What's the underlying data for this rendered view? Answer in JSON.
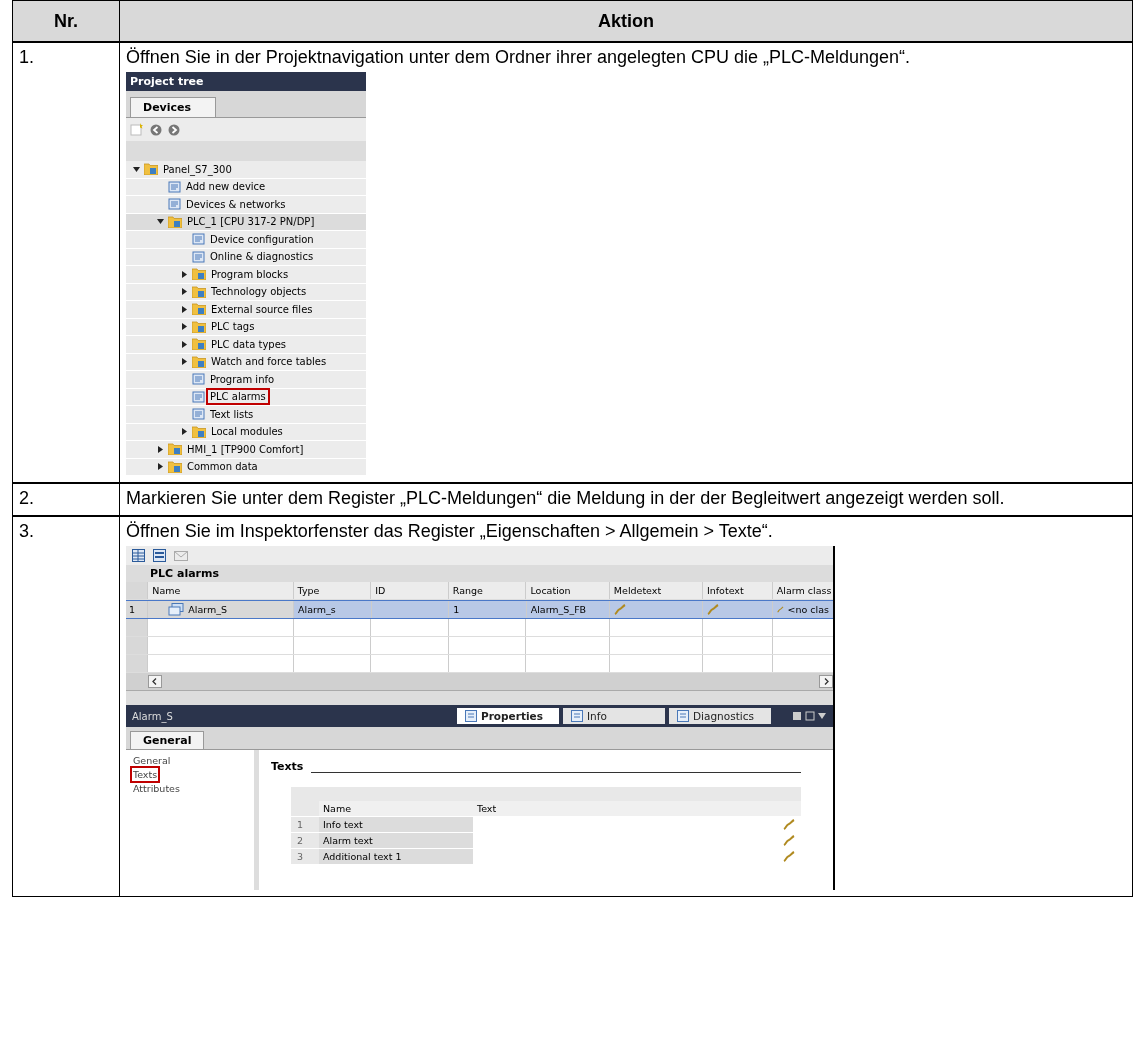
{
  "table": {
    "columns": [
      "Nr.",
      "Aktion"
    ],
    "rows": [
      {
        "number": "1.",
        "text": "Öffnen Sie in der Projektnavigation unter dem Ordner ihrer angelegten CPU die „PLC-Meldungen“.",
        "figure": {
          "kind": "project_tree",
          "title": "Project tree",
          "tab": "Devices",
          "items": [
            {
              "label": "Panel_S7_300",
              "expanded": true,
              "highlighted": false,
              "children": [
                {
                  "label": "Add new device",
                  "highlighted": false
                },
                {
                  "label": "Devices & networks",
                  "highlighted": false
                },
                {
                  "label": "PLC_1 [CPU 317-2 PN/DP]",
                  "expanded": true,
                  "highlighted": false,
                  "children": [
                    {
                      "label": "Device configuration",
                      "highlighted": false
                    },
                    {
                      "label": "Online & diagnostics",
                      "highlighted": false
                    },
                    {
                      "label": "Program blocks",
                      "expanded": false,
                      "highlighted": false
                    },
                    {
                      "label": "Technology objects",
                      "expanded": false,
                      "highlighted": false
                    },
                    {
                      "label": "External source files",
                      "expanded": false,
                      "highlighted": false
                    },
                    {
                      "label": "PLC tags",
                      "expanded": false,
                      "highlighted": false
                    },
                    {
                      "label": "PLC data types",
                      "expanded": false,
                      "highlighted": false
                    },
                    {
                      "label": "Watch and force tables",
                      "expanded": false,
                      "highlighted": false
                    },
                    {
                      "label": "Program info",
                      "highlighted": false
                    },
                    {
                      "label": "PLC alarms",
                      "highlighted": true
                    },
                    {
                      "label": "Text lists",
                      "highlighted": false
                    },
                    {
                      "label": "Local modules",
                      "expanded": false,
                      "highlighted": false
                    }
                  ]
                },
                {
                  "label": "HMI_1 [TP900 Comfort]",
                  "expanded": false,
                  "highlighted": false
                },
                {
                  "label": "Common data",
                  "expanded": false,
                  "highlighted": false
                }
              ]
            }
          ]
        }
      },
      {
        "number": "2.",
        "text": "Markieren Sie unter dem Register „PLC-Meldungen“ die Meldung in der der Begleitwert angezeigt werden soll."
      },
      {
        "number": "3.",
        "text": "Öffnen Sie im Inspektorfenster das Register „Eigenschaften > Allgemein > Texte“.",
        "figure": {
          "kind": "alarm_editor",
          "title": "PLC alarms",
          "columns": [
            "Name",
            "Type",
            "ID",
            "Range",
            "Location",
            "Meldetext",
            "Infotext",
            "Alarm class"
          ],
          "rows": [
            {
              "number": "1",
              "name": "Alarm_S",
              "type": "Alarm_s",
              "range": "1",
              "location": "Alarm_S_FB",
              "alarm_class": "<no clas",
              "selected": true
            }
          ],
          "inspector": {
            "title": "Alarm_S",
            "tabs": [
              {
                "label": "Properties",
                "selected": true
              },
              {
                "label": "Info",
                "selected": false
              },
              {
                "label": "Diagnostics",
                "selected": false
              }
            ],
            "subtab": "General",
            "nav": [
              {
                "label": "General",
                "highlighted": false
              },
              {
                "label": "Texts",
                "highlighted": true
              },
              {
                "label": "Attributes",
                "highlighted": false
              }
            ],
            "section": "Texts",
            "columns": [
              "Name",
              "Text"
            ],
            "rows": [
              {
                "number": "1",
                "name": "Info text"
              },
              {
                "number": "2",
                "name": "Alarm text"
              },
              {
                "number": "3",
                "name": "Additional text 1"
              }
            ]
          }
        }
      }
    ]
  }
}
